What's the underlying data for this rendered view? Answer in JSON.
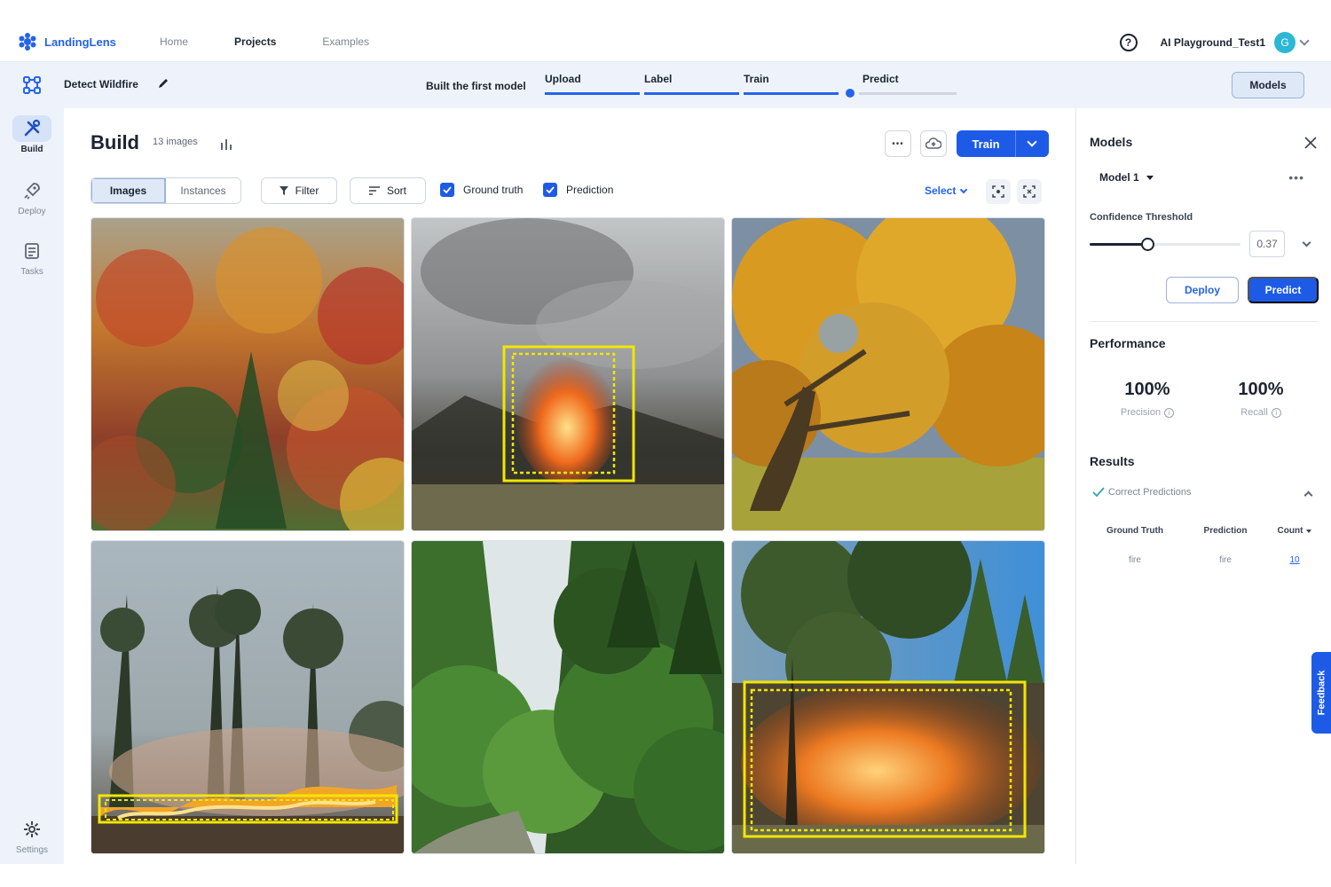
{
  "topnav": {
    "brand": "LandingLens",
    "links": [
      {
        "label": "Home",
        "active": false
      },
      {
        "label": "Projects",
        "active": true
      },
      {
        "label": "Examples",
        "active": false
      }
    ],
    "help_glyph": "?",
    "org": "AI Playground_Test1",
    "avatar_initial": "G"
  },
  "project": {
    "name": "Detect Wildfire",
    "progress_title": "Built the first model",
    "steps": [
      {
        "label": "Upload",
        "state": "done"
      },
      {
        "label": "Label",
        "state": "done"
      },
      {
        "label": "Train",
        "state": "done"
      },
      {
        "label": "Predict",
        "state": "current"
      }
    ],
    "models_button": "Models"
  },
  "rail": {
    "items": [
      {
        "label": "Build",
        "icon": "tools-icon",
        "active": true
      },
      {
        "label": "Deploy",
        "icon": "rocket-icon",
        "active": false
      },
      {
        "label": "Tasks",
        "icon": "tasks-icon",
        "active": false
      }
    ],
    "settings_label": "Settings"
  },
  "build": {
    "title": "Build",
    "count": "13 images",
    "more_glyph": "•••",
    "train_label": "Train",
    "view_tabs": [
      {
        "label": "Images",
        "active": true
      },
      {
        "label": "Instances",
        "active": false
      }
    ],
    "filter_label": "Filter",
    "sort_label": "Sort",
    "ground_truth_label": "Ground truth",
    "prediction_label": "Prediction",
    "select_label": "Select",
    "images": [
      {
        "scene": "autumn-forest",
        "annotated": false
      },
      {
        "scene": "smoky-fire",
        "annotated": true
      },
      {
        "scene": "autumn-tree",
        "annotated": false
      },
      {
        "scene": "forest-fire-line",
        "annotated": true
      },
      {
        "scene": "green-forest",
        "annotated": false
      },
      {
        "scene": "pine-forest-fire",
        "annotated": true
      }
    ]
  },
  "panel": {
    "title": "Models",
    "model_name": "Model 1",
    "more_glyph": "•••",
    "confidence_label": "Confidence Threshold",
    "confidence_value": "0.37",
    "deploy_label": "Deploy",
    "predict_label": "Predict",
    "performance_title": "Performance",
    "precision_value": "100%",
    "precision_label": "Precision",
    "recall_value": "100%",
    "recall_label": "Recall",
    "info_glyph": "i",
    "results_title": "Results",
    "correct_label": "Correct Predictions",
    "headers": {
      "ground_truth": "Ground Truth",
      "prediction": "Prediction",
      "count": "Count"
    },
    "rows": [
      {
        "ground_truth": "fire",
        "prediction": "fire",
        "count": "10"
      }
    ]
  },
  "feedback_label": "Feedback",
  "colors": {
    "accent": "#1d5be7",
    "annotation": "#f2e600"
  }
}
